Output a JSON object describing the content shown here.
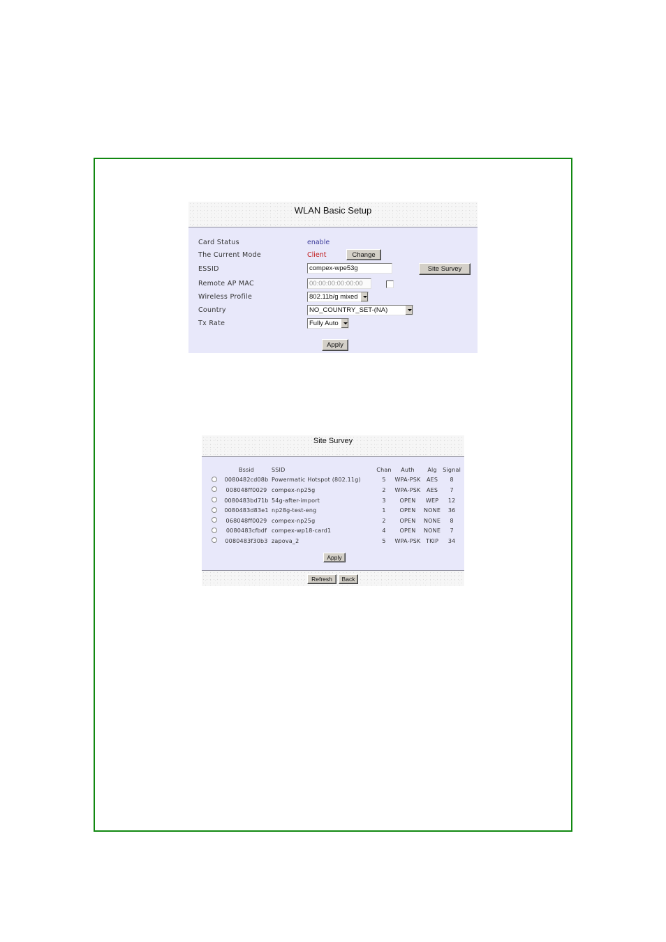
{
  "wlan_setup": {
    "title": "WLAN Basic Setup",
    "fields": {
      "card_status": {
        "label": "Card Status",
        "value": "enable",
        "color": "#3b3b9a"
      },
      "current_mode": {
        "label": "The Current Mode",
        "value": "Client",
        "color": "#c01818",
        "button": "Change"
      },
      "essid": {
        "label": "ESSID",
        "value": "compex-wpe53g",
        "button": "Site Survey"
      },
      "remote_ap_mac": {
        "label": "Remote AP MAC",
        "value": "00:00:00:00:00:00",
        "checked": false
      },
      "wireless_profile": {
        "label": "Wireless Profile",
        "selected": "802.11b/g mixed"
      },
      "country": {
        "label": "Country",
        "selected": "NO_COUNTRY_SET-(NA)"
      },
      "tx_rate": {
        "label": "Tx Rate",
        "selected": "Fully Auto"
      }
    },
    "apply_label": "Apply"
  },
  "site_survey": {
    "title": "Site Survey",
    "columns": [
      "",
      "Bssid",
      "SSID",
      "Chan",
      "Auth",
      "Alg",
      "Signal"
    ],
    "rows": [
      {
        "bssid": "0080482cd08b",
        "ssid": "Powermatic Hotspot (802.11g)",
        "chan": "5",
        "auth": "WPA-PSK",
        "alg": "AES",
        "signal": "8"
      },
      {
        "bssid": "008048ff0029",
        "ssid": "compex-np25g",
        "chan": "2",
        "auth": "WPA-PSK",
        "alg": "AES",
        "signal": "7"
      },
      {
        "bssid": "0080483bd71b",
        "ssid": "54g-after-import",
        "chan": "3",
        "auth": "OPEN",
        "alg": "WEP",
        "signal": "12"
      },
      {
        "bssid": "0080483d83e1",
        "ssid": "np28g-test-eng",
        "chan": "1",
        "auth": "OPEN",
        "alg": "NONE",
        "signal": "36"
      },
      {
        "bssid": "068048ff0029",
        "ssid": "compex-np25g",
        "chan": "2",
        "auth": "OPEN",
        "alg": "NONE",
        "signal": "8"
      },
      {
        "bssid": "0080483cfbdf",
        "ssid": "compex-wp18-card1",
        "chan": "4",
        "auth": "OPEN",
        "alg": "NONE",
        "signal": "7"
      },
      {
        "bssid": "0080483f30b3",
        "ssid": "zapova_2",
        "chan": "5",
        "auth": "WPA-PSK",
        "alg": "TKIP",
        "signal": "34"
      }
    ],
    "apply_label": "Apply",
    "refresh_label": "Refresh",
    "back_label": "Back"
  },
  "colors": {
    "frame": "#118811",
    "panel_bg": "#e8e8fa"
  }
}
